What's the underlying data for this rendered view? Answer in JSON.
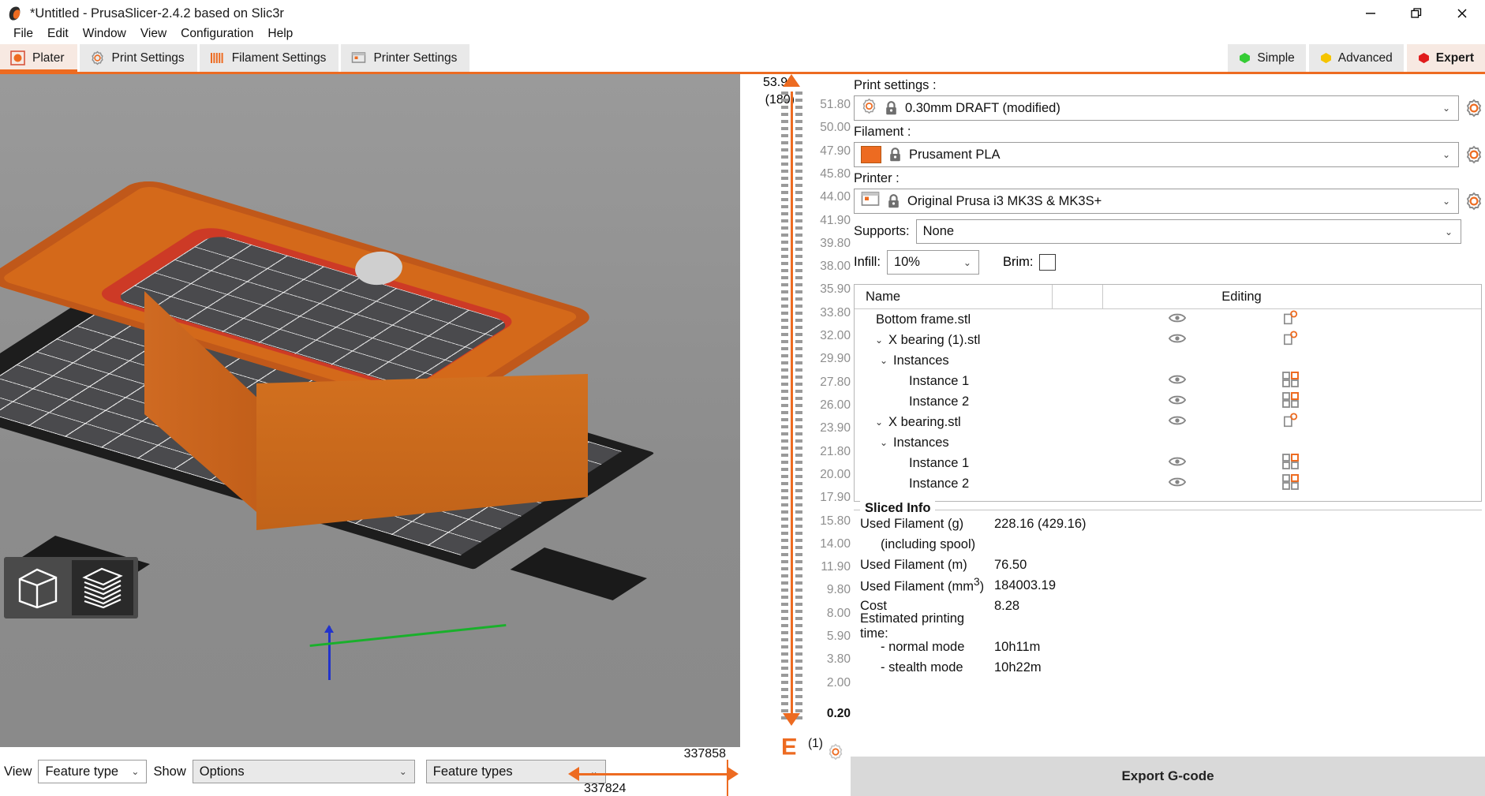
{
  "window": {
    "title": "*Untitled - PrusaSlicer-2.4.2 based on Slic3r",
    "minimize": "—",
    "restore": "❐",
    "close": "✕"
  },
  "menu": [
    "File",
    "Edit",
    "Window",
    "View",
    "Configuration",
    "Help"
  ],
  "tabs": [
    {
      "label": "Plater",
      "icon": "plater-icon",
      "active": true
    },
    {
      "label": "Print Settings",
      "icon": "print-settings-gear-icon",
      "active": false
    },
    {
      "label": "Filament Settings",
      "icon": "filament-spool-icon",
      "active": false
    },
    {
      "label": "Printer Settings",
      "icon": "printer-icon",
      "active": false
    }
  ],
  "modes": [
    {
      "label": "Simple",
      "color": "#35cc35",
      "active": false
    },
    {
      "label": "Advanced",
      "color": "#f5c400",
      "active": false
    },
    {
      "label": "Expert",
      "color": "#e01b1b",
      "active": true
    }
  ],
  "settings": {
    "print_label": "Print settings :",
    "print_value": "0.30mm DRAFT (modified)",
    "filament_label": "Filament :",
    "filament_value": "Prusament PLA",
    "filament_color": "#ed6b21",
    "printer_label": "Printer :",
    "printer_value": "Original Prusa i3 MK3S & MK3S+",
    "supports_label": "Supports:",
    "supports_value": "None",
    "infill_label": "Infill:",
    "infill_value": "10%",
    "brim_label": "Brim:",
    "chevron": "⌄"
  },
  "object_list": {
    "col_name": "Name",
    "col_editing": "Editing",
    "rows": [
      {
        "label": "Bottom frame.stl",
        "indent": 1,
        "caret": "",
        "eye": true,
        "edit": "settings"
      },
      {
        "label": "X bearing (1).stl",
        "indent": 0,
        "caret": "⌄",
        "eye": true,
        "edit": "settings"
      },
      {
        "label": "Instances",
        "indent": 2,
        "caret": "⌄",
        "eye": false,
        "edit": ""
      },
      {
        "label": "Instance 1",
        "indent": 3,
        "caret": "",
        "eye": true,
        "edit": "instances"
      },
      {
        "label": "Instance 2",
        "indent": 3,
        "caret": "",
        "eye": true,
        "edit": "instances"
      },
      {
        "label": "X bearing.stl",
        "indent": 0,
        "caret": "⌄",
        "eye": true,
        "edit": "settings"
      },
      {
        "label": "Instances",
        "indent": 2,
        "caret": "⌄",
        "eye": false,
        "edit": ""
      },
      {
        "label": "Instance 1",
        "indent": 3,
        "caret": "",
        "eye": true,
        "edit": "instances"
      },
      {
        "label": "Instance 2",
        "indent": 3,
        "caret": "",
        "eye": true,
        "edit": "instances"
      }
    ]
  },
  "sliced_info": {
    "title": "Sliced Info",
    "rows": [
      {
        "key": "Used Filament (g)",
        "value": "228.16 (429.16)",
        "indent": false
      },
      {
        "key": "(including spool)",
        "value": "",
        "indent": true
      },
      {
        "key": "Used Filament (m)",
        "value": "76.50",
        "indent": false
      },
      {
        "key": "Used Filament (mm³)",
        "value": "184003.19",
        "indent": false
      },
      {
        "key": "Cost",
        "value": "8.28",
        "indent": false
      },
      {
        "key": "Estimated printing time:",
        "value": "",
        "indent": false
      },
      {
        "key": "- normal mode",
        "value": "10h11m",
        "indent": true
      },
      {
        "key": "- stealth mode",
        "value": "10h22m",
        "indent": true
      }
    ]
  },
  "export_button": "Export G-code",
  "bottom_bar": {
    "view_label": "View",
    "view_value": "Feature type",
    "show_label": "Show",
    "show_value": "Options",
    "feature_value": "Feature types",
    "chevron": "⌄"
  },
  "layer_slider": {
    "top_value": "53.90",
    "top_layer": "(180)",
    "bottom_value": "0.20",
    "bottom_layer": "(1)",
    "ticks": [
      "51.80",
      "50.00",
      "47.90",
      "45.80",
      "44.00",
      "41.90",
      "39.80",
      "38.00",
      "35.90",
      "33.80",
      "32.00",
      "29.90",
      "27.80",
      "26.00",
      "23.90",
      "21.80",
      "20.00",
      "17.90",
      "15.80",
      "14.00",
      "11.90",
      "9.80",
      "8.00",
      "5.90",
      "3.80",
      "2.00"
    ]
  },
  "move_slider": {
    "high_value": "337858",
    "low_value": "337824"
  }
}
